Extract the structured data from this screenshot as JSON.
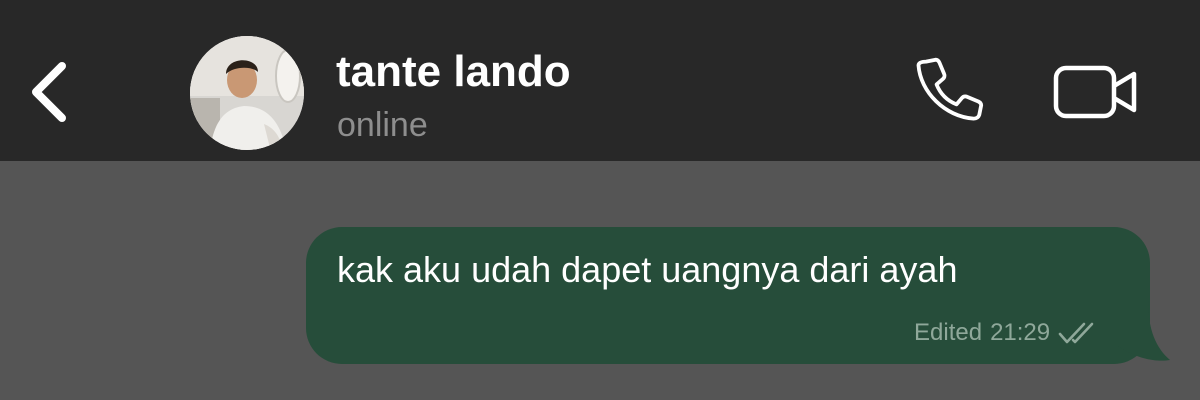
{
  "header": {
    "back_icon": "chevron-left-icon",
    "contact_name": "tante lando",
    "status": "online",
    "call_icon": "phone-icon",
    "video_icon": "video-camera-icon"
  },
  "messages": [
    {
      "direction": "outgoing",
      "text": "kak aku udah dapet uangnya dari ayah",
      "edited_label": "Edited",
      "time": "21:29",
      "status_icon": "double-check-icon"
    }
  ],
  "colors": {
    "header_bg": "#282828",
    "chat_bg": "#555555",
    "bubble_bg": "#264d3a",
    "status_text": "#8e8e8e",
    "meta_text": "#8fa89a"
  }
}
